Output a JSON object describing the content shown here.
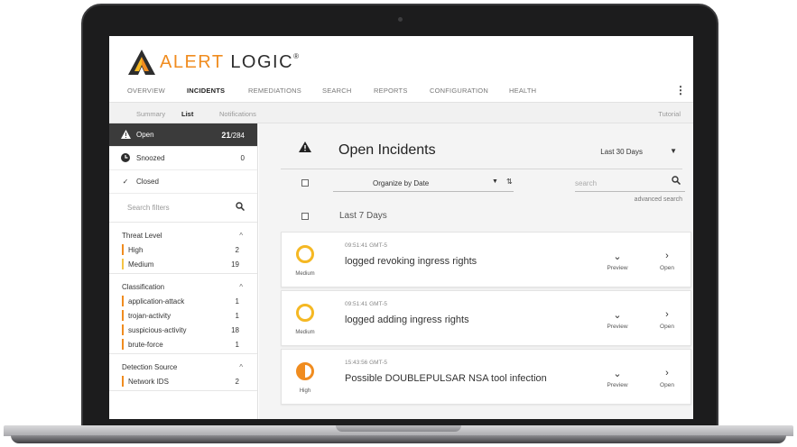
{
  "brand": {
    "alert": "ALERT",
    "logic": "LOGIC",
    "reg": "®",
    "orange": "#f08c1f"
  },
  "topnav": [
    "OVERVIEW",
    "INCIDENTS",
    "REMEDIATIONS",
    "SEARCH",
    "REPORTS",
    "CONFIGURATION",
    "HEALTH"
  ],
  "topnav_active": "INCIDENTS",
  "menu_icon": "kebab-icon",
  "subnav": {
    "summary": "Summary",
    "list": "List",
    "notifications": "Notifications",
    "tutorial": "Tutorial"
  },
  "states": {
    "open": {
      "label": "Open",
      "count": "21",
      "total": "/284"
    },
    "snoozed": {
      "label": "Snoozed",
      "count": "0"
    },
    "closed": {
      "label": "Closed"
    }
  },
  "filters": {
    "search_placeholder": "Search filters",
    "groups": [
      {
        "title": "Threat Level",
        "items": [
          {
            "label": "High",
            "count": "2",
            "color": "#f08c1f"
          },
          {
            "label": "Medium",
            "count": "19",
            "color": "#f5c445"
          }
        ]
      },
      {
        "title": "Classification",
        "items": [
          {
            "label": "application-attack",
            "count": "1"
          },
          {
            "label": "trojan-activity",
            "count": "1"
          },
          {
            "label": "suspicious-activity",
            "count": "18"
          },
          {
            "label": "brute-force",
            "count": "1"
          }
        ]
      },
      {
        "title": "Detection Source",
        "items": [
          {
            "label": "Network IDS",
            "count": "2"
          }
        ]
      }
    ]
  },
  "main": {
    "title": "Open Incidents",
    "range": "Last 30 Days",
    "organize": "Organize by Date",
    "search_placeholder": "search",
    "advanced": "advanced search",
    "section": "Last 7 Days",
    "preview": "Preview",
    "open": "Open"
  },
  "incidents": [
    {
      "time": "09:51:41 GMT-5",
      "name": "logged revoking ingress rights",
      "severity": "Medium"
    },
    {
      "time": "09:51:41 GMT-5",
      "name": "logged adding ingress rights",
      "severity": "Medium"
    },
    {
      "time": "15:43:56 GMT-5",
      "name": "Possible DOUBLEPULSAR NSA tool infection",
      "severity": "High"
    }
  ]
}
